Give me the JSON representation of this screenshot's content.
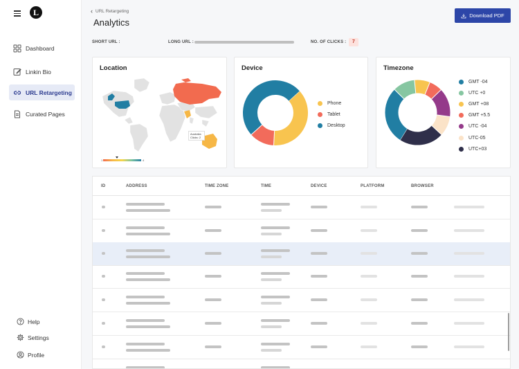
{
  "sidebar": {
    "logo_letter": "L",
    "items": [
      {
        "label": "Dashboard",
        "icon": "grid-icon"
      },
      {
        "label": "Linkin Bio",
        "icon": "edit-icon"
      },
      {
        "label": "URL Retargeting",
        "icon": "link-icon",
        "active": true
      },
      {
        "label": "Curated Pages",
        "icon": "document-icon"
      }
    ],
    "footer": [
      {
        "label": "Help",
        "icon": "help-icon"
      },
      {
        "label": "Settings",
        "icon": "gear-icon"
      },
      {
        "label": "Profile",
        "icon": "user-icon"
      }
    ]
  },
  "header": {
    "breadcrumb": "URL Retargeting",
    "title": "Analytics",
    "download_label": "Download PDF"
  },
  "meta": {
    "short_url_label": "SHORT URL :",
    "long_url_label": "LONG URL :",
    "clicks_label": "NO. OF CLICKS :",
    "clicks_value": "7"
  },
  "location": {
    "title": "Location",
    "tooltip_country": "Australia",
    "tooltip_clicks": "Clicks: 2",
    "scale_min": "1",
    "scale_max": "4"
  },
  "device": {
    "title": "Device",
    "legend": [
      {
        "name": "Phone",
        "color": "#f8c44f",
        "value": 3
      },
      {
        "name": "Tablet",
        "color": "#f26b5b",
        "value": 1
      },
      {
        "name": "Desktop",
        "color": "#217ea3",
        "value": 4
      }
    ]
  },
  "timezone": {
    "title": "Timezone",
    "legend": [
      {
        "name": "GMT -04",
        "color": "#217ea3",
        "value": 26
      },
      {
        "name": "UTC +0",
        "color": "#86c6a1",
        "value": 10
      },
      {
        "name": "GMT +08",
        "color": "#f8c44f",
        "value": 7
      },
      {
        "name": "GMT +5.5",
        "color": "#f26b5b",
        "value": 6
      },
      {
        "name": "UTC -04",
        "color": "#943a8a",
        "value": 13
      },
      {
        "name": "UTC-05",
        "color": "#fbe3c8",
        "value": 9
      },
      {
        "name": "UTC+03",
        "color": "#2f2f4a",
        "value": 20
      }
    ]
  },
  "table": {
    "columns": [
      "ID",
      "ADDRESS",
      "TIME ZONE",
      "TIME",
      "DEVICE",
      "PLATFORM",
      "BROWSER"
    ]
  }
}
